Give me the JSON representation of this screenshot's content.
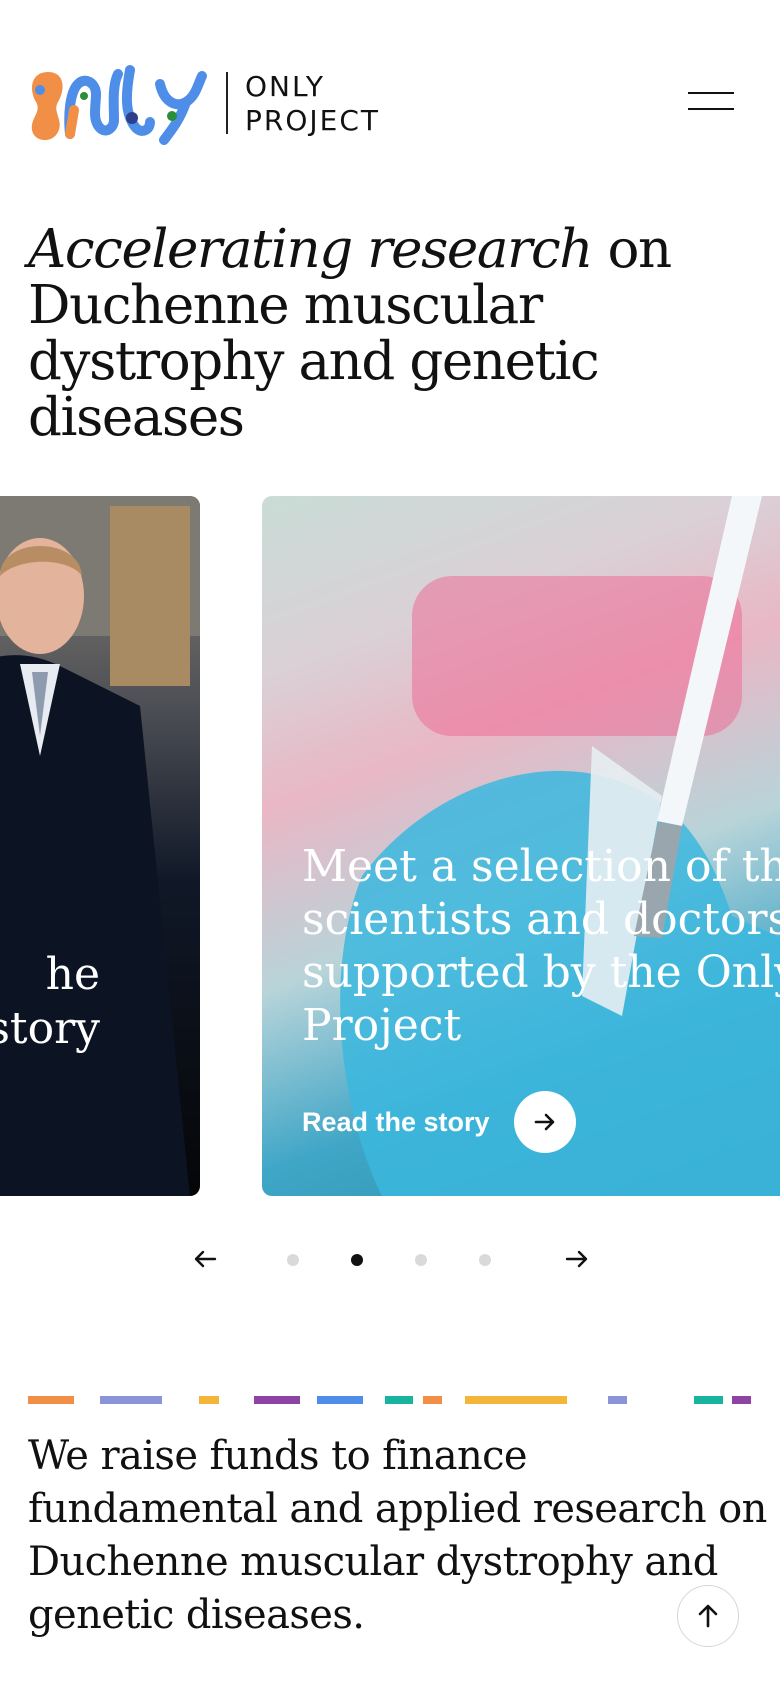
{
  "brand": {
    "logo_word": "only",
    "name_line1": "ONLY",
    "name_line2": "PROJECT",
    "colors": {
      "orange": "#f08f45",
      "blue": "#4f8ee8",
      "green": "#2a8f3a",
      "navy": "#2b3f8c"
    }
  },
  "header": {
    "menu_icon": "hamburger-icon"
  },
  "hero": {
    "title_italic": "Accelerating research",
    "title_rest": " on Duchenne muscular dystrophy and genetic diseases"
  },
  "carousel": {
    "left_card": {
      "title_line1": "he",
      "title_line2": "story"
    },
    "right_card": {
      "title_lines": [
        "Meet a selection of th",
        "scientists and doctors",
        "supported by the Only",
        "Project"
      ],
      "cta_label": "Read the story",
      "cta_icon": "arrow-right-icon"
    },
    "prev_icon": "arrow-left-icon",
    "next_icon": "arrow-right-icon",
    "slide_count": 4,
    "active_slide": 2
  },
  "color_bar": [
    "#f08f45",
    "#8c94d8",
    "#f4b63a",
    "#8e44a5",
    "#4f8ee8",
    "#19b4a0",
    "#f08f45",
    "#f4b63a",
    "#8c94d8",
    "#19b4a0",
    "#8e44a5"
  ],
  "mission": {
    "text": "We raise funds to finance fundamental and applied research on Duchenne muscular dystrophy and genetic diseases."
  },
  "scroll_top": {
    "icon": "arrow-up-icon"
  }
}
